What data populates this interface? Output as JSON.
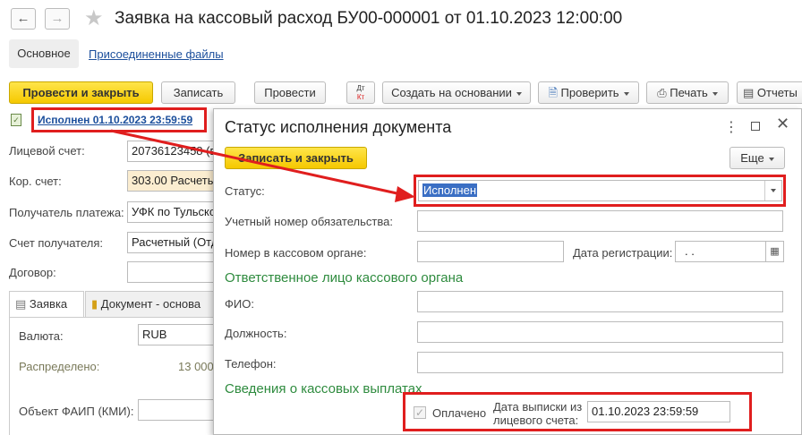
{
  "window": {
    "title": "Заявка на кассовый расход БУ00-000001 от 01.10.2023 12:00:00",
    "tabs": [
      "Основное",
      "Присоединенные файлы"
    ]
  },
  "toolbar": {
    "post_close": "Провести и закрыть",
    "write": "Записать",
    "post": "Провести",
    "dtkt_top": "Дт",
    "dtkt_bottom": "Кт",
    "create_based": "Создать на основании",
    "check": "Проверить",
    "print": "Печать",
    "reports": "Отчеты"
  },
  "status_link": "Исполнен 01.10.2023 23:59:59",
  "form": {
    "personal_account_label": "Лицевой счет:",
    "personal_account_value": "20736123458 (в",
    "cor_account_label": "Кор. счет:",
    "cor_account_value": "303.00 Расчеты",
    "recipient_label": "Получатель платежа:",
    "recipient_value": "УФК по Тульско",
    "recipient_account_label": "Счет получателя:",
    "recipient_account_value": "Расчетный (Отд",
    "contract_label": "Договор:",
    "tabs": [
      "Заявка",
      "Документ - основа"
    ],
    "currency_label": "Валюта:",
    "currency_value": "RUB",
    "distributed_label": "Распределено:",
    "distributed_value": "13 000",
    "faip_label": "Объект ФАИП (КМИ):"
  },
  "dialog": {
    "title": "Статус исполнения документа",
    "save_close": "Записать и закрыть",
    "more": "Еще",
    "status_label": "Статус:",
    "status_value": "Исполнен",
    "obligation_label": "Учетный номер обязательства:",
    "cash_number_label": "Номер в кассовом органе:",
    "reg_date_label": "Дата регистрации:",
    "reg_date_value": ".   .",
    "section_responsible": "Ответственное лицо кассового органа",
    "fio_label": "ФИО:",
    "position_label": "Должность:",
    "phone_label": "Телефон:",
    "section_payments": "Сведения о кассовых выплатах",
    "paid_label": "Оплачено",
    "statement_date_label_1": "Дата выписки из",
    "statement_date_label_2": "лицевого счета:",
    "statement_date_value": "01.10.2023 23:59:59"
  }
}
